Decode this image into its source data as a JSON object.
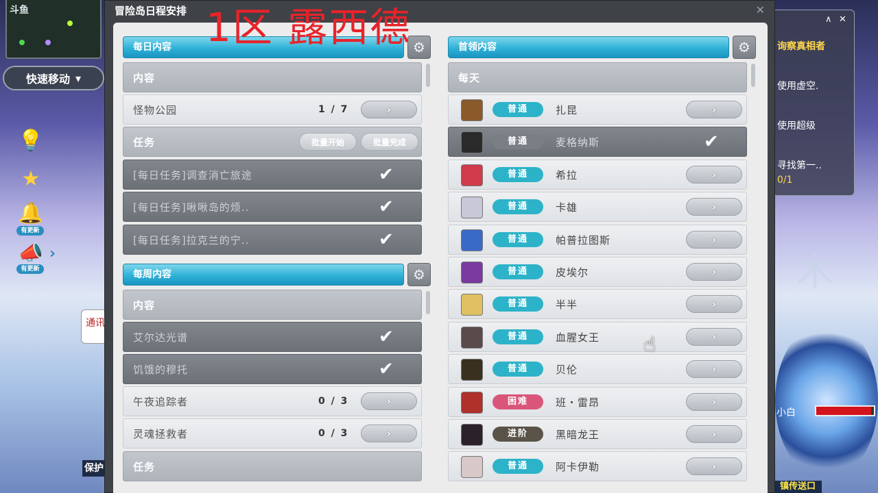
{
  "hud": {
    "quick_move": "快速移动",
    "new_badge": "有更新",
    "chat_bubble": "通讯",
    "bottom_left_label": "保护",
    "portal_label": "镇传送口",
    "player_name": "小白",
    "hp_fraction": 0.95
  },
  "right_panel": {
    "lines": [
      "询察真相者",
      "使用虚空.",
      "使用超级",
      "寻找第一..",
      "0/1"
    ]
  },
  "window": {
    "title": "冒险岛日程安排",
    "overlay_text": "1区  露西德",
    "close": "✕"
  },
  "daily": {
    "header": "每日内容",
    "content_label": "内容",
    "monster_park": {
      "label": "怪物公园",
      "count": "1 / 7"
    },
    "task_label": "任务",
    "batch_start": "批量开始",
    "batch_complete": "批量完成",
    "quests": [
      "[每日任务]调查消亡旅途",
      "[每日任务]啾啾岛的烦..",
      "[每日任务]拉克兰的宁.."
    ]
  },
  "weekly": {
    "header": "每周内容",
    "content_label": "内容",
    "done_items": [
      "艾尔达光谱",
      "饥饿的穆托"
    ],
    "counted_items": [
      {
        "label": "午夜追踪者",
        "count": "0 / 3"
      },
      {
        "label": "灵魂拯救者",
        "count": "0 / 3"
      }
    ],
    "task_label": "任务"
  },
  "boss": {
    "header": "首领内容",
    "subheader": "每天",
    "rows": [
      {
        "badge": "普通",
        "name": "扎昆",
        "done": false,
        "badge_color": "#2db3c9",
        "avatar_color": "#8a5a2b"
      },
      {
        "badge": "普通",
        "name": "麦格纳斯",
        "done": true,
        "badge_color": "#2db3c9",
        "avatar_color": "#2a2a2a"
      },
      {
        "badge": "普通",
        "name": "希拉",
        "done": false,
        "badge_color": "#2db3c9",
        "avatar_color": "#d03a4a"
      },
      {
        "badge": "普通",
        "name": "卡雄",
        "done": false,
        "badge_color": "#2db3c9",
        "avatar_color": "#c8c8d8"
      },
      {
        "badge": "普通",
        "name": "帕普拉图斯",
        "done": false,
        "badge_color": "#2db3c9",
        "avatar_color": "#3a6ac8"
      },
      {
        "badge": "普通",
        "name": "皮埃尔",
        "done": false,
        "badge_color": "#2db3c9",
        "avatar_color": "#7a3aa0"
      },
      {
        "badge": "普通",
        "name": "半半",
        "done": false,
        "badge_color": "#2db3c9",
        "avatar_color": "#e0c060"
      },
      {
        "badge": "普通",
        "name": "血腥女王",
        "done": false,
        "badge_color": "#2db3c9",
        "avatar_color": "#5a4a4a"
      },
      {
        "badge": "普通",
        "name": "贝伦",
        "done": false,
        "badge_color": "#2db3c9",
        "avatar_color": "#3a3020"
      },
      {
        "badge": "困难",
        "name": "班・雷昂",
        "done": false,
        "badge_color": "#d9567a",
        "avatar_color": "#b0302a"
      },
      {
        "badge": "进阶",
        "name": "黑暗龙王",
        "done": false,
        "badge_color": "#5a5348",
        "avatar_color": "#2a2228"
      },
      {
        "badge": "普通",
        "name": "阿卡伊勒",
        "done": false,
        "badge_color": "#2db3c9",
        "avatar_color": "#d8c8c8"
      }
    ]
  },
  "icons": {
    "gear": "⚙",
    "arrow": "›",
    "check": "✔",
    "cursor": "☝"
  }
}
